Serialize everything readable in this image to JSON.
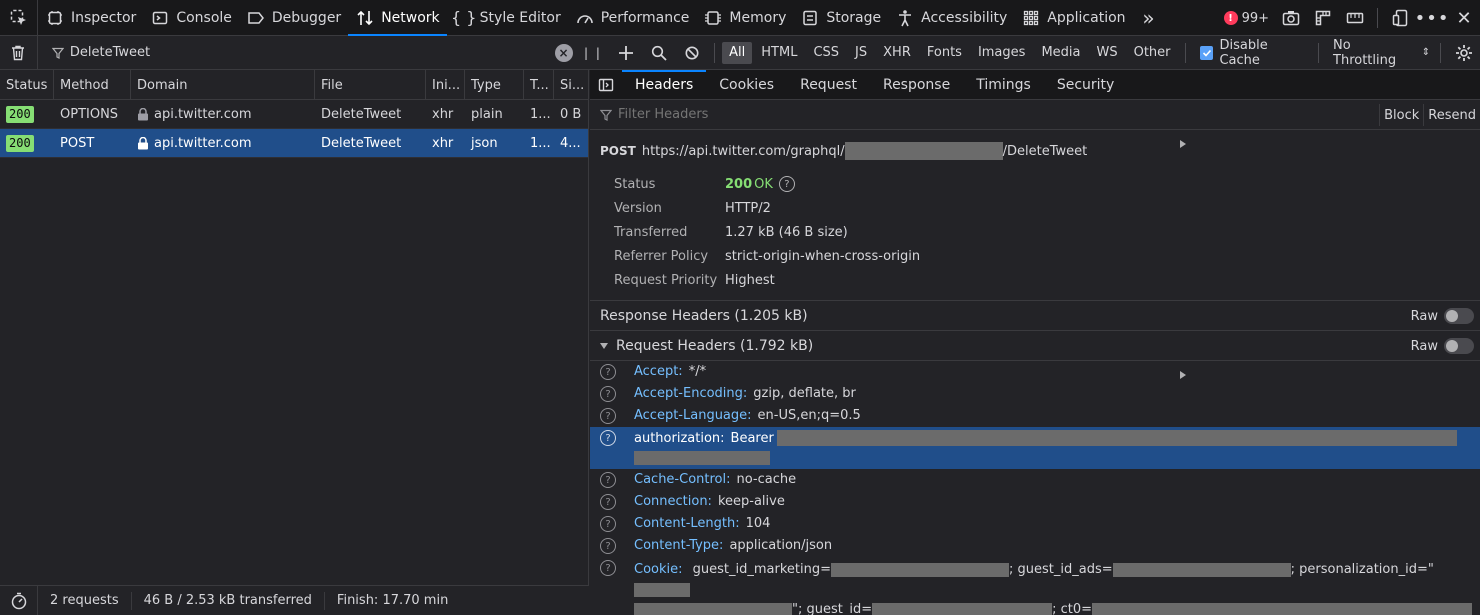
{
  "toolbar": {
    "tabs": [
      {
        "label": "Inspector",
        "icon": "inspector-icon"
      },
      {
        "label": "Console",
        "icon": "console-icon"
      },
      {
        "label": "Debugger",
        "icon": "debugger-icon"
      },
      {
        "label": "Network",
        "icon": "network-icon",
        "active": true
      },
      {
        "label": "Style Editor",
        "icon": "style-editor-icon"
      },
      {
        "label": "Performance",
        "icon": "performance-icon"
      },
      {
        "label": "Memory",
        "icon": "memory-icon"
      },
      {
        "label": "Storage",
        "icon": "storage-icon"
      },
      {
        "label": "Accessibility",
        "icon": "accessibility-icon"
      },
      {
        "label": "Application",
        "icon": "application-icon"
      }
    ],
    "error_count": "99+"
  },
  "filter": {
    "value": "DeleteTweet",
    "types": [
      "All",
      "HTML",
      "CSS",
      "JS",
      "XHR",
      "Fonts",
      "Images",
      "Media",
      "WS",
      "Other"
    ],
    "active_type": "All",
    "disable_cache_label": "Disable Cache",
    "throttling": "No Throttling"
  },
  "requests": {
    "columns": [
      "Status",
      "Method",
      "Domain",
      "File",
      "Ini...",
      "Type",
      "T...",
      "Si..."
    ],
    "rows": [
      {
        "status": "200",
        "method": "OPTIONS",
        "domain": "api.twitter.com",
        "file": "DeleteTweet",
        "initiator": "xhr",
        "type": "plain",
        "transferred": "1...",
        "size": "0 B"
      },
      {
        "status": "200",
        "method": "POST",
        "domain": "api.twitter.com",
        "file": "DeleteTweet",
        "initiator": "xhr",
        "type": "json",
        "transferred": "1...",
        "size": "4..."
      }
    ]
  },
  "footer": {
    "requests": "2 requests",
    "transferred": "46 B / 2.53 kB transferred",
    "finish": "Finish: 17.70 min"
  },
  "panel": {
    "tabs": [
      "Headers",
      "Cookies",
      "Request",
      "Response",
      "Timings",
      "Security"
    ],
    "active_tab": "Headers",
    "filter_placeholder": "Filter Headers",
    "block_label": "Block",
    "resend_label": "Resend",
    "url": {
      "method": "POST",
      "prefix": "https://api.twitter.com/graphql/",
      "suffix": "/DeleteTweet"
    },
    "summary": {
      "status_label": "Status",
      "status_code": "200",
      "status_text": "OK",
      "version_label": "Version",
      "version": "HTTP/2",
      "transferred_label": "Transferred",
      "transferred": "1.27 kB (46 B size)",
      "referrer_label": "Referrer Policy",
      "referrer": "strict-origin-when-cross-origin",
      "priority_label": "Request Priority",
      "priority": "Highest"
    },
    "response_headers_label": "Response Headers (1.205 kB)",
    "request_headers_label": "Request Headers (1.792 kB)",
    "raw_label": "Raw",
    "request_headers": [
      {
        "name": "Accept:",
        "value": "*/*"
      },
      {
        "name": "Accept-Encoding:",
        "value": "gzip, deflate, br"
      },
      {
        "name": "Accept-Language:",
        "value": "en-US,en;q=0.5"
      },
      {
        "name": "authorization:",
        "value": "Bearer"
      },
      {
        "name": "Cache-Control:",
        "value": "no-cache"
      },
      {
        "name": "Connection:",
        "value": "keep-alive"
      },
      {
        "name": "Content-Length:",
        "value": "104"
      },
      {
        "name": "Content-Type:",
        "value": "application/json"
      },
      {
        "name": "Cookie:",
        "value": "guest_id_marketing="
      }
    ],
    "cookie_parts": [
      "; guest_id_ads=",
      "; personalization_id=\"",
      "\"; guest_id=",
      "; ct0="
    ]
  }
}
